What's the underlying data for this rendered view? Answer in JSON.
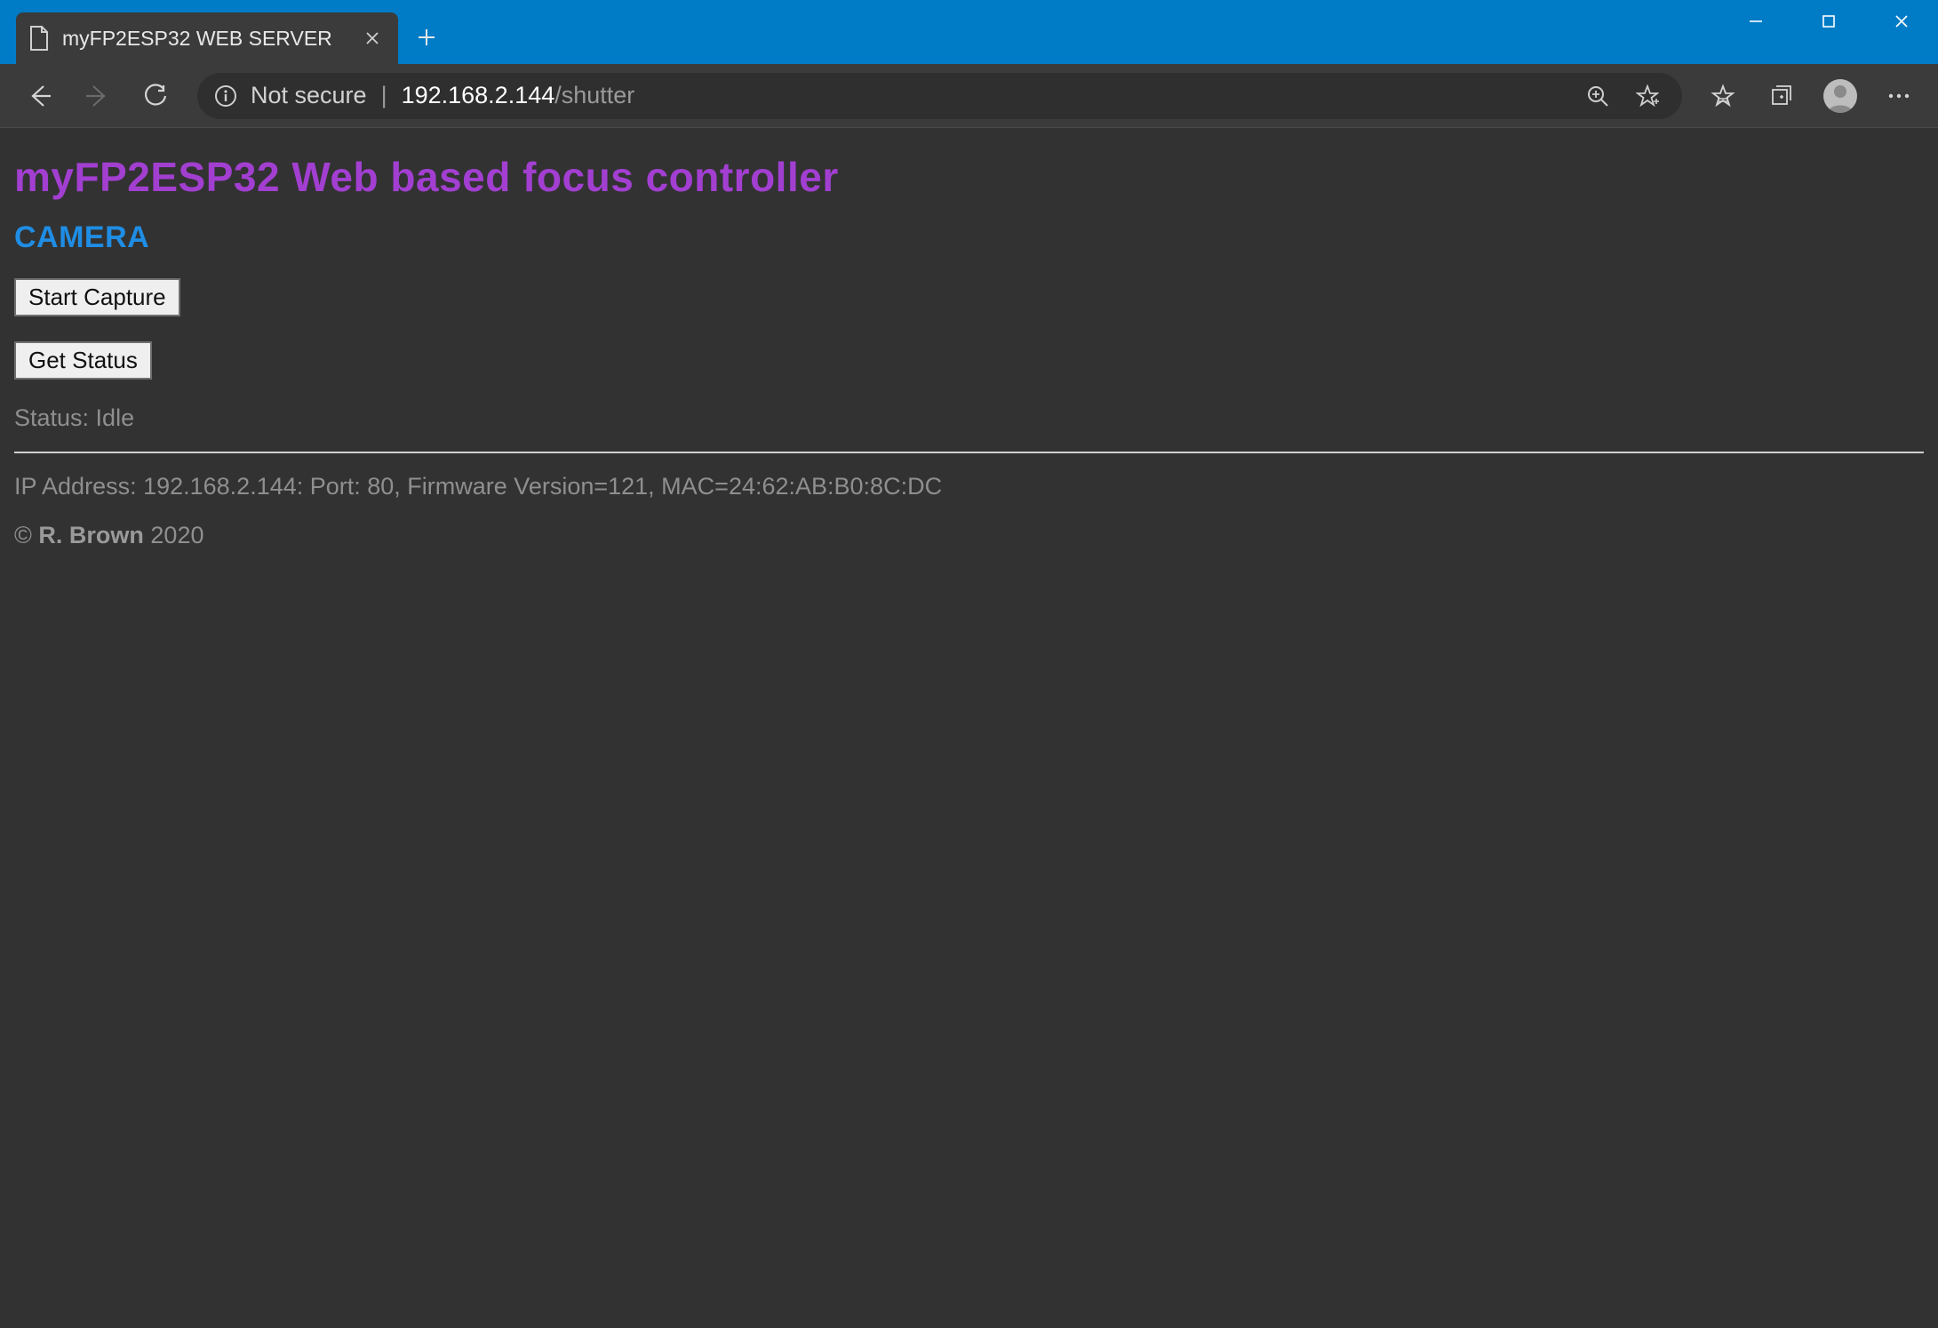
{
  "browser": {
    "tab_title": "myFP2ESP32 WEB SERVER",
    "address": {
      "security_label": "Not secure",
      "host": "192.168.2.144",
      "path": "/shutter"
    }
  },
  "page": {
    "heading": "myFP2ESP32 Web based focus controller",
    "section": "CAMERA",
    "buttons": {
      "start_capture": "Start Capture",
      "get_status": "Get Status"
    },
    "status_line": "Status: Idle",
    "info_line": "IP Address: 192.168.2.144: Port: 80, Firmware Version=121, MAC=24:62:AB:B0:8C:DC",
    "copyright_prefix": "© ",
    "copyright_author": "R. Brown",
    "copyright_year": " 2020"
  }
}
